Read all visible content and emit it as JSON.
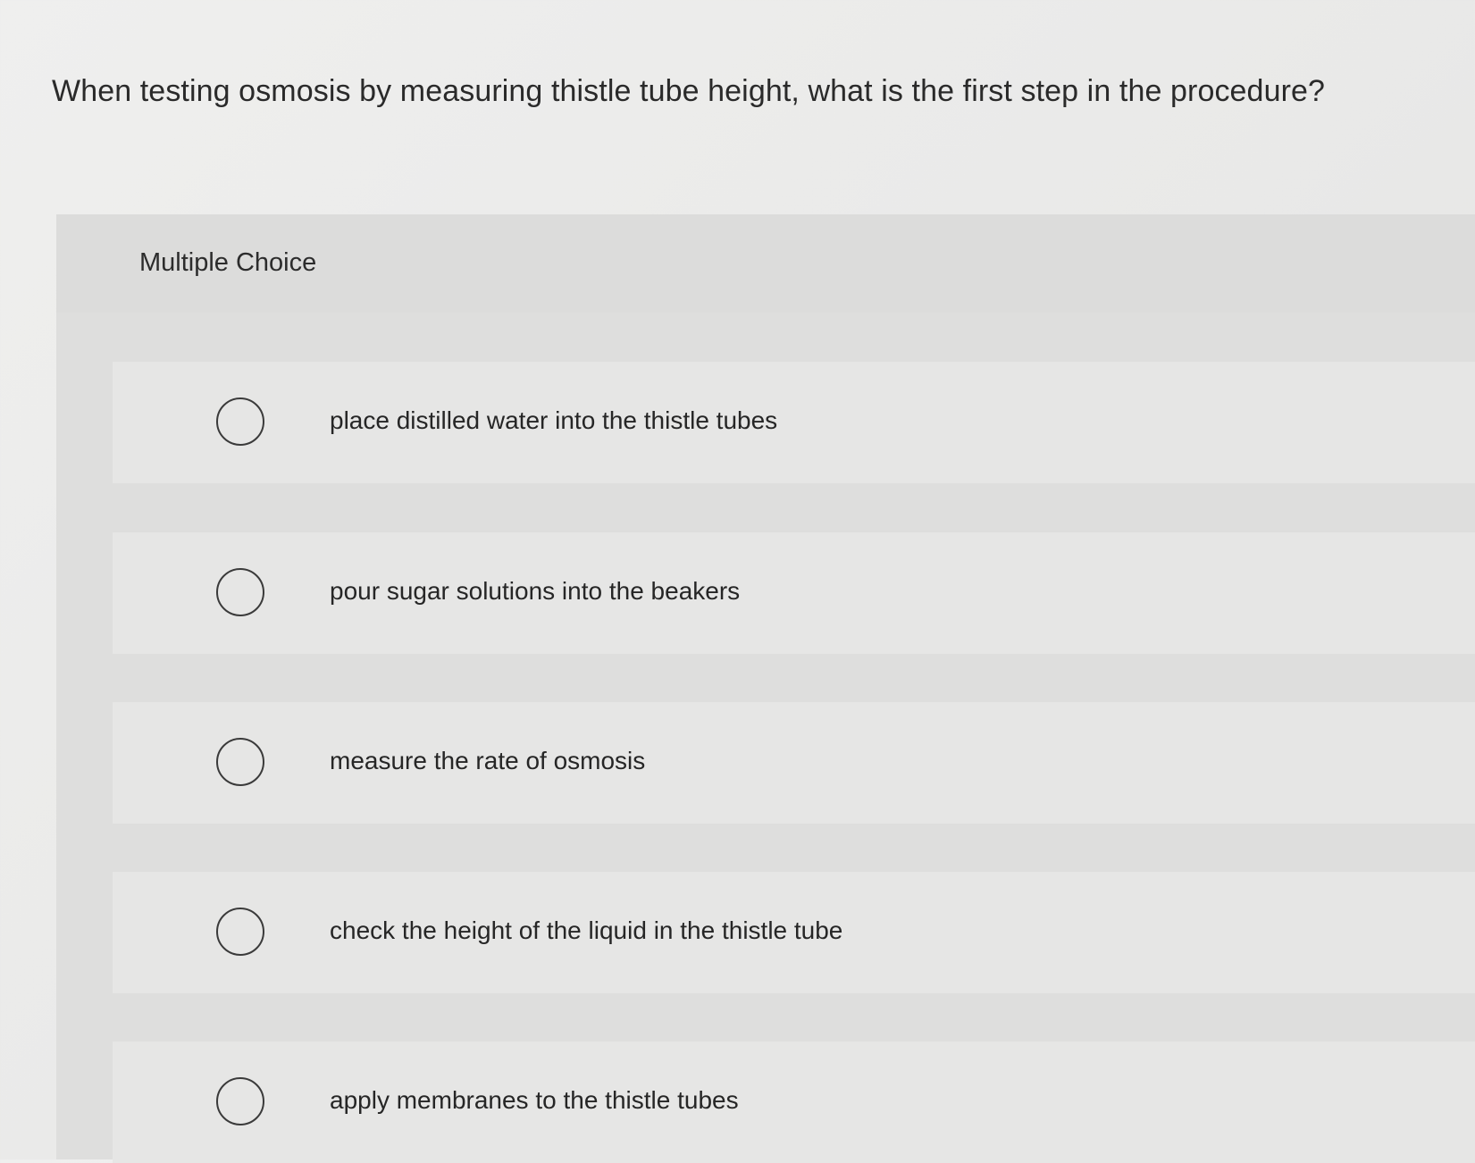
{
  "question": {
    "text": "When testing osmosis by measuring thistle tube height, what is the first step in the procedure?"
  },
  "answer_panel": {
    "type_label": "Multiple Choice",
    "options": [
      {
        "label": "place distilled water into the thistle tubes",
        "selected": false
      },
      {
        "label": "pour sugar solutions into the beakers",
        "selected": false
      },
      {
        "label": "measure the rate of osmosis",
        "selected": false
      },
      {
        "label": "check the height of the liquid in the thistle tube",
        "selected": false
      },
      {
        "label": "apply membranes to the thistle tubes",
        "selected": false
      }
    ]
  }
}
